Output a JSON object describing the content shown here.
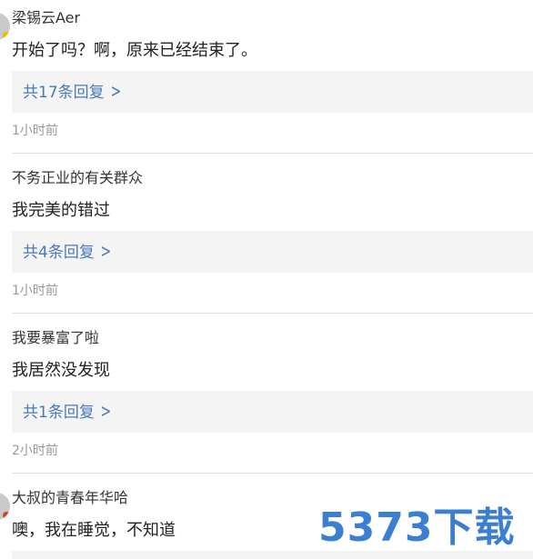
{
  "comments": [
    {
      "user": "梁锡云Aer",
      "text": "开始了吗？啊，原来已经结束了。",
      "replies": "共17条回复",
      "time": "1小时前"
    },
    {
      "user": "不务正业的有关群众",
      "text": "我完美的错过",
      "replies": "共4条回复",
      "time": "1小时前"
    },
    {
      "user": "我要暴富了啦",
      "text": "我居然没发现",
      "replies": "共1条回复",
      "time": "2小时前"
    },
    {
      "user": "大叔的青春年华哈",
      "text": "噢，我在睡觉，不知道",
      "replies": "",
      "time": ""
    }
  ],
  "icons": {
    "reply_arrow": "chevron-right-icon"
  },
  "colors": {
    "link": "#4a7ab5",
    "badge_yellow": "#f5b800",
    "badge_red": "#e03a2e"
  },
  "watermark": "5373下载"
}
